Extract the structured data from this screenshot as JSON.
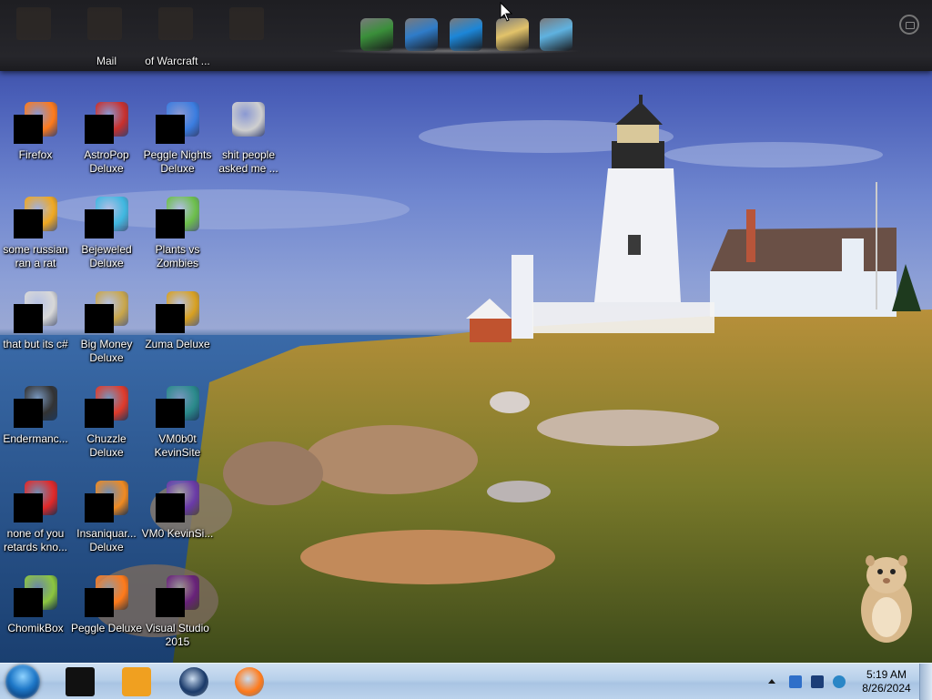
{
  "top_dock": {
    "ghost_labels": [
      "Mail",
      "of Warcraft ..."
    ],
    "icons": [
      {
        "name": "computer-icon",
        "color": "#3a8f3a"
      },
      {
        "name": "network-icon",
        "color": "#2f7cc9"
      },
      {
        "name": "internet-explorer-icon",
        "color": "#1c86d8"
      },
      {
        "name": "mail-icon",
        "color": "#e2c36a"
      },
      {
        "name": "people-icon",
        "color": "#5fb2e0"
      }
    ]
  },
  "desktop": {
    "icons": [
      {
        "label": "Firefox",
        "icon": "firefox-icon",
        "color": "#ff7a1a"
      },
      {
        "label": "AstroPop Deluxe",
        "icon": "astropop-icon",
        "color": "#c9302c"
      },
      {
        "label": "Peggle Nights Deluxe",
        "icon": "peggle-nights-icon",
        "color": "#3b7de0"
      },
      {
        "label": "shit people asked me ...",
        "icon": "folder-icon",
        "color": "#cfcfcf"
      },
      {
        "label": "some russian ran a rat",
        "icon": "ie-folder-icon",
        "color": "#f0a820"
      },
      {
        "label": "Bejeweled Deluxe",
        "icon": "bejeweled-icon",
        "color": "#3fb7e0"
      },
      {
        "label": "Plants vs Zombies",
        "icon": "pvz-icon",
        "color": "#6cbf4a"
      },
      {
        "label": "that but its c#",
        "icon": "files-icon",
        "color": "#d8d8d8"
      },
      {
        "label": "Big Money Deluxe",
        "icon": "big-money-icon",
        "color": "#c9a64a"
      },
      {
        "label": "Zuma Deluxe",
        "icon": "zuma-icon",
        "color": "#d8a020"
      },
      {
        "label": "Endermanc...",
        "icon": "console-icon",
        "color": "#333333"
      },
      {
        "label": "Chuzzle Deluxe",
        "icon": "chuzzle-icon",
        "color": "#e03a2a"
      },
      {
        "label": "VM0b0t KevinSite",
        "icon": "vm-icon",
        "color": "#2a8a8a"
      },
      {
        "label": "none of you retards kno...",
        "icon": "opera-icon",
        "color": "#e22828"
      },
      {
        "label": "Insaniquar... Deluxe",
        "icon": "insaniquarium-icon",
        "color": "#f08a20"
      },
      {
        "label": "VM0 KevinSi...",
        "icon": "vm2-icon",
        "color": "#6a3aa8"
      },
      {
        "label": "ChomikBox",
        "icon": "chomikbox-icon",
        "color": "#8cc63f"
      },
      {
        "label": "Peggle Deluxe",
        "icon": "peggle-icon",
        "color": "#ff7a1a"
      },
      {
        "label": "Visual Studio 2015",
        "icon": "visual-studio-icon",
        "color": "#68217a"
      }
    ]
  },
  "taskbar": {
    "items": [
      {
        "name": "start-orb",
        "label": "Start"
      },
      {
        "name": "app-black-icon",
        "color": "#111111"
      },
      {
        "name": "media-player-icon",
        "color": "#f0a020"
      },
      {
        "name": "globe-icon",
        "color": "#1a3a6a"
      },
      {
        "name": "firefox-taskbar-icon",
        "color": "#ff7a1a"
      }
    ],
    "tray": {
      "time": "5:19 AM",
      "date": "8/26/2024",
      "icons": [
        "show-hidden-icon",
        "flag-icon",
        "display-icon",
        "network-tray-icon"
      ]
    }
  }
}
